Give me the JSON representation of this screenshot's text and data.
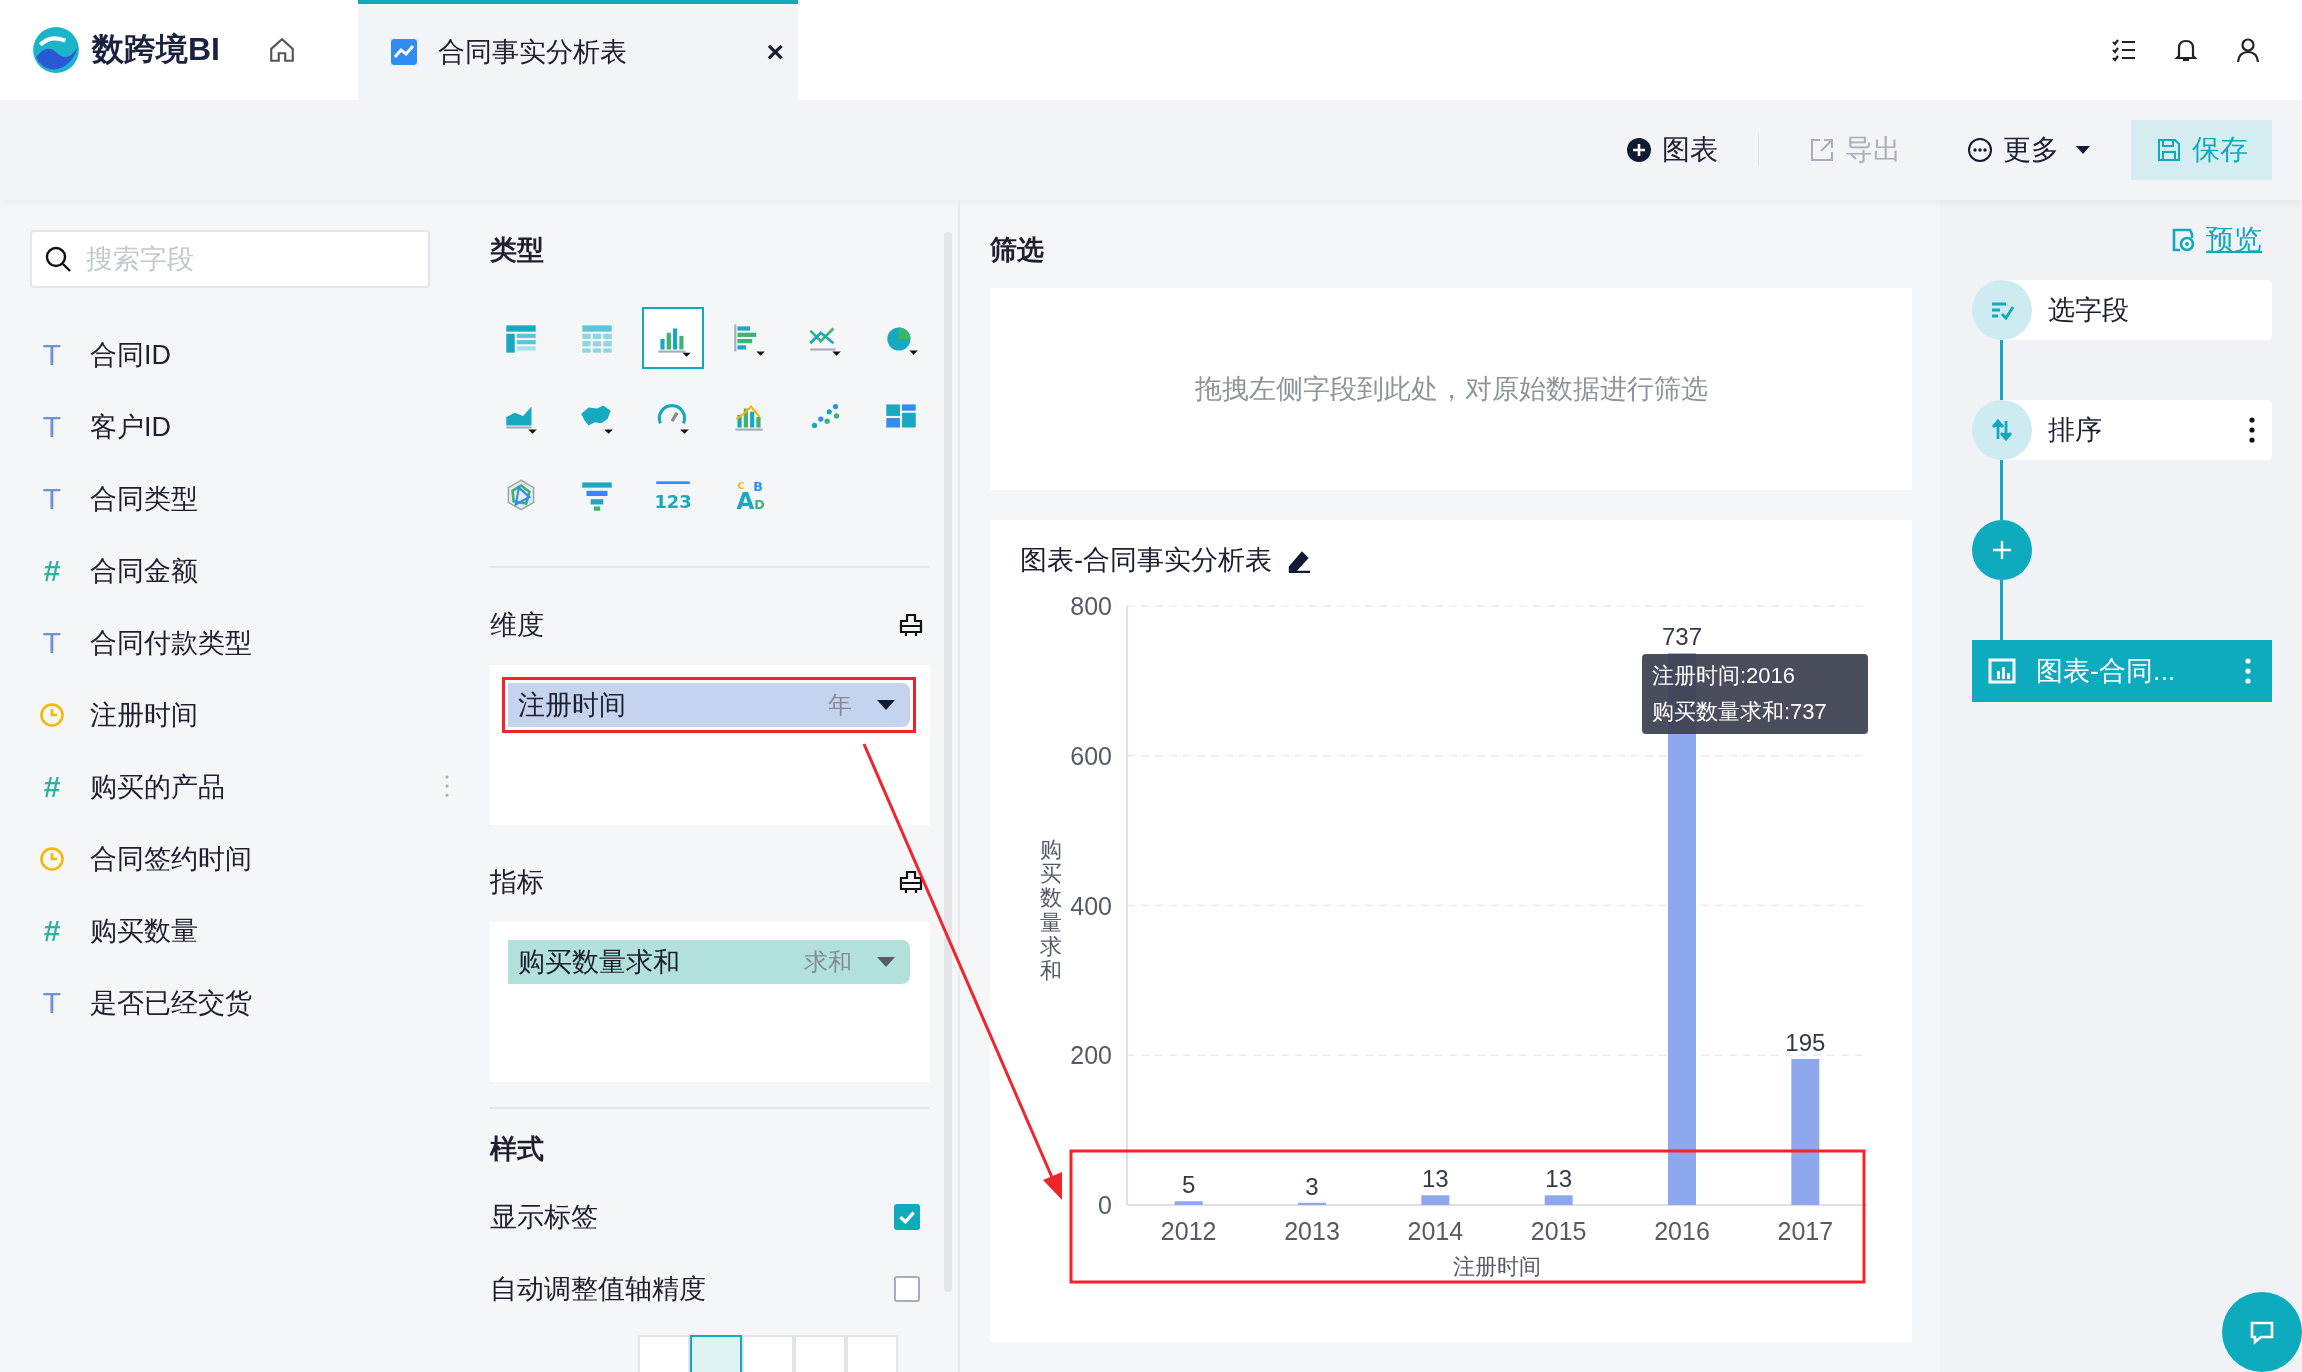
{
  "header": {
    "logo_text": "数跨境BI",
    "tab": {
      "title": "合同事实分析表",
      "close": "×",
      "selected": true
    }
  },
  "toolbar": {
    "buttons": [
      {
        "kind": "add",
        "label": "图表",
        "disabled": false
      },
      {
        "kind": "export",
        "label": "导出",
        "disabled": true
      },
      {
        "kind": "more",
        "label": "更多",
        "disabled": false
      },
      {
        "kind": "save",
        "label": "保存",
        "disabled": false
      }
    ]
  },
  "field_panel": {
    "search": {
      "placeholder": "搜索字段"
    },
    "fields": [
      {
        "kind": "text",
        "icon": "T",
        "name": "合同ID"
      },
      {
        "kind": "text",
        "icon": "T",
        "name": "客户ID"
      },
      {
        "kind": "text",
        "icon": "T",
        "name": "合同类型"
      },
      {
        "kind": "number",
        "icon": "#",
        "name": "合同金额"
      },
      {
        "kind": "text",
        "icon": "T",
        "name": "合同付款类型"
      },
      {
        "kind": "time",
        "name": "注册时间"
      },
      {
        "kind": "number",
        "icon": "#",
        "name": "购买的产品"
      },
      {
        "kind": "time",
        "name": "合同签约时间"
      },
      {
        "kind": "number",
        "icon": "#",
        "name": "购买数量"
      },
      {
        "kind": "text",
        "icon": "T",
        "name": "是否已经交货"
      }
    ]
  },
  "config_panel": {
    "type_title": "类型",
    "chart_types": [
      {
        "kind": "table",
        "selected": false
      },
      {
        "kind": "pivot",
        "selected": false
      },
      {
        "kind": "bar",
        "selected": true
      },
      {
        "kind": "hbar",
        "selected": false
      },
      {
        "kind": "line",
        "selected": false
      },
      {
        "kind": "pie",
        "selected": false
      },
      {
        "kind": "area",
        "selected": false
      },
      {
        "kind": "map",
        "selected": false
      },
      {
        "kind": "gauge",
        "selected": false
      },
      {
        "kind": "combo",
        "selected": false
      },
      {
        "kind": "scatter",
        "selected": false
      },
      {
        "kind": "tile",
        "selected": false
      },
      {
        "kind": "radar",
        "selected": false
      },
      {
        "kind": "funnel",
        "selected": false
      },
      {
        "kind": "kpi",
        "selected": false,
        "label": "123"
      },
      {
        "kind": "wordcloud",
        "selected": false,
        "label": "CABD"
      }
    ],
    "dimension": {
      "title": "维度",
      "pill": {
        "name": "注册时间",
        "aggregation": "年",
        "highlighted": true
      }
    },
    "measure": {
      "title": "指标",
      "pill": {
        "name": "购买数量求和",
        "aggregation": "求和",
        "highlighted": false
      }
    },
    "style": {
      "title": "样式",
      "options": [
        {
          "label": "显示标签",
          "checked": true
        },
        {
          "label": "自动调整值轴精度",
          "checked": false
        }
      ],
      "segments": [
        {
          "selected": false
        },
        {
          "selected": true
        },
        {
          "selected": false
        },
        {
          "selected": false
        },
        {
          "selected": false
        }
      ]
    }
  },
  "filter": {
    "title": "筛选",
    "placeholder": "拖拽左侧字段到此处，对原始数据进行筛选"
  },
  "chart_card": {
    "title": "图表-合同事实分析表",
    "highlighted_axis": true,
    "tooltip": [
      "注册时间:2016",
      "购买数量求和:737"
    ],
    "chart_data": {
      "type": "bar",
      "xlabel": "注册时间",
      "ylabel": "购买数量求和",
      "categories": [
        "2012",
        "2013",
        "2014",
        "2015",
        "2016",
        "2017"
      ],
      "values": [
        5,
        3,
        13,
        13,
        737,
        195
      ],
      "ylim": [
        0,
        800
      ],
      "grid": true,
      "yticks": [
        0,
        200,
        400,
        600,
        800
      ],
      "data_labels": true
    }
  },
  "flow_panel": {
    "preview": "预览",
    "steps": [
      {
        "kind": "fields",
        "label": "选字段",
        "menu": false,
        "selected": false
      },
      {
        "kind": "sort",
        "label": "排序",
        "menu": true,
        "selected": false
      },
      {
        "kind": "add"
      },
      {
        "kind": "chart",
        "label": "图表-合同...",
        "menu": true,
        "selected": true
      }
    ]
  }
}
